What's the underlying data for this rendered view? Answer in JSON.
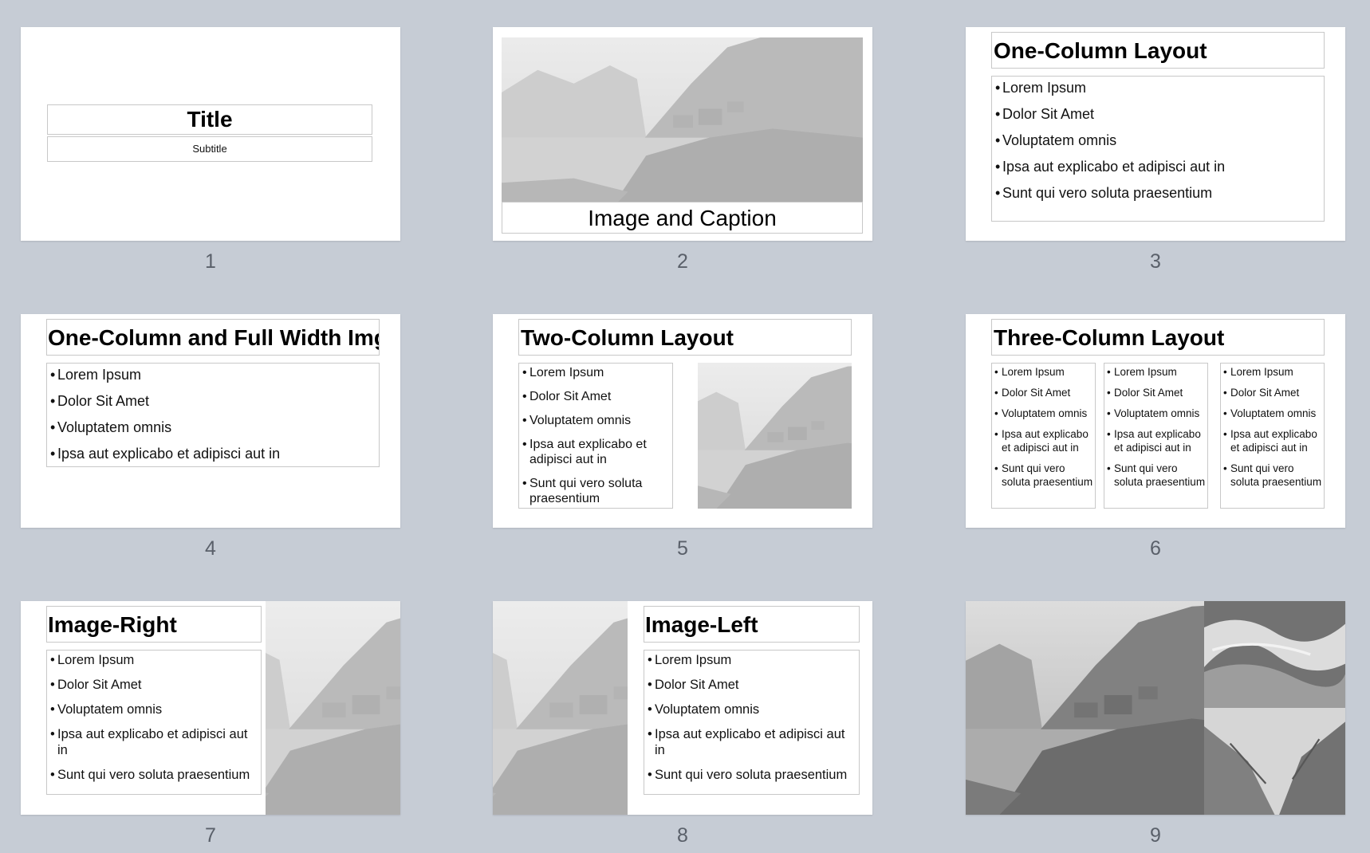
{
  "slides": [
    {
      "number": "1",
      "layout": "title",
      "title": "Title",
      "subtitle": "Subtitle"
    },
    {
      "number": "2",
      "layout": "image-caption",
      "caption": "Image and Caption"
    },
    {
      "number": "3",
      "layout": "one-column",
      "title": "One-Column Layout",
      "bullets": [
        "Lorem Ipsum",
        "Dolor Sit Amet",
        "Voluptatem omnis",
        "Ipsa aut explicabo et adipisci aut in",
        "Sunt qui vero soluta praesentium"
      ]
    },
    {
      "number": "4",
      "layout": "one-column-full-image",
      "title": "One-Column and Full Width Img",
      "bullets": [
        "Lorem Ipsum",
        "Dolor Sit Amet",
        "Voluptatem omnis",
        "Ipsa aut explicabo et adipisci aut in"
      ]
    },
    {
      "number": "5",
      "layout": "two-column",
      "title": "Two-Column Layout",
      "bullets": [
        "Lorem Ipsum",
        "Dolor Sit Amet",
        "Voluptatem omnis",
        "Ipsa aut explicabo et adipisci aut in",
        "Sunt qui vero soluta praesentium"
      ]
    },
    {
      "number": "6",
      "layout": "three-column",
      "title": "Three-Column Layout",
      "columns": [
        [
          "Lorem Ipsum",
          "Dolor Sit Amet",
          "Voluptatem omnis",
          "Ipsa aut explicabo et adipisci aut in",
          "Sunt qui vero soluta praesentium"
        ],
        [
          "Lorem Ipsum",
          "Dolor Sit Amet",
          "Voluptatem omnis",
          "Ipsa aut explicabo et adipisci aut in",
          "Sunt qui vero soluta praesentium"
        ],
        [
          "Lorem Ipsum",
          "Dolor Sit Amet",
          "Voluptatem omnis",
          "Ipsa aut explicabo et adipisci aut in",
          "Sunt qui vero soluta praesentium"
        ]
      ]
    },
    {
      "number": "7",
      "layout": "image-right",
      "title": "Image-Right",
      "bullets": [
        "Lorem Ipsum",
        "Dolor Sit Amet",
        "Voluptatem omnis",
        "Ipsa aut explicabo et adipisci aut in",
        "Sunt qui vero soluta praesentium"
      ]
    },
    {
      "number": "8",
      "layout": "image-left",
      "title": "Image-Left",
      "bullets": [
        "Lorem Ipsum",
        "Dolor Sit Amet",
        "Voluptatem omnis",
        "Ipsa aut explicabo et adipisci aut in",
        "Sunt qui vero soluta praesentium"
      ]
    },
    {
      "number": "9",
      "layout": "photo-collage"
    }
  ],
  "colors": {
    "background": "#c6ccd5",
    "slide": "#ffffff",
    "number_text": "#5a606a",
    "placeholder_border": "#c8c8c8"
  }
}
